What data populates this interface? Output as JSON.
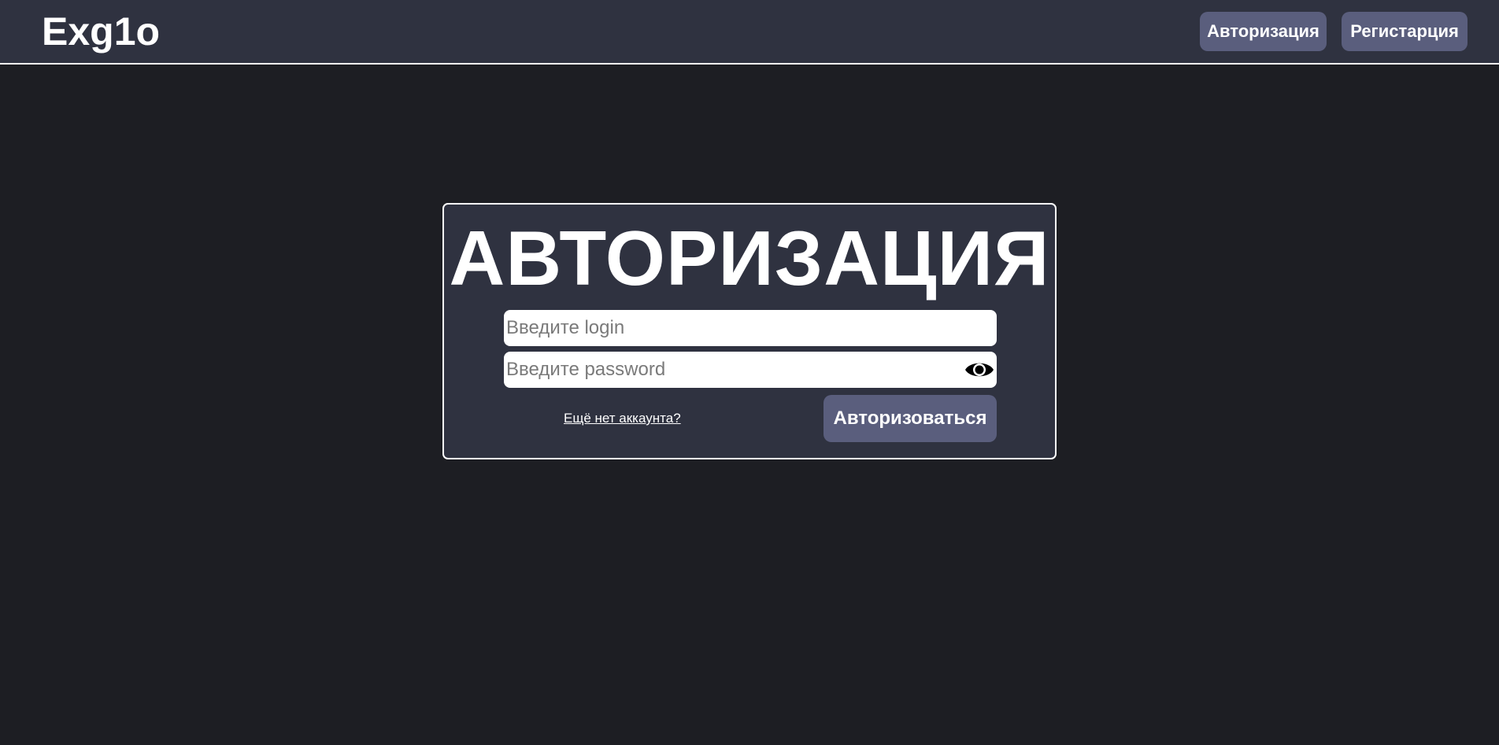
{
  "header": {
    "logo": "Exg1o",
    "nav": {
      "login_label": "Авторизация",
      "register_label": "Регистарция"
    }
  },
  "auth_card": {
    "title": "АВТОРИЗАЦИЯ",
    "login_field": {
      "placeholder": "Введите login",
      "value": ""
    },
    "password_field": {
      "placeholder": "Введите password",
      "value": "",
      "toggle_icon": "eye-icon"
    },
    "signup_link": "Ещё нет аккаунта?",
    "submit_label": "Авторизоваться"
  },
  "colors": {
    "page_background": "#1d1e23",
    "header_background": "#2f3240",
    "card_background": "#2f3240",
    "button_background": "#5a5e7d",
    "text": "#ffffff"
  }
}
